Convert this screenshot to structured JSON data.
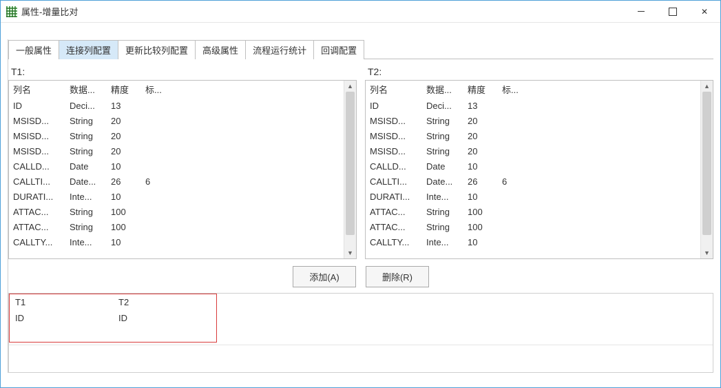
{
  "window": {
    "title": "属性-增量比对"
  },
  "tabs": [
    {
      "label": "一般属性"
    },
    {
      "label": "连接列配置"
    },
    {
      "label": "更新比较列配置"
    },
    {
      "label": "高级属性"
    },
    {
      "label": "流程运行统计"
    },
    {
      "label": "回调配置"
    }
  ],
  "active_tab_index": 1,
  "panes": {
    "left_label": "T1:",
    "right_label": "T2:"
  },
  "grid_headers": {
    "name": "列名",
    "dtype": "数据...",
    "prec": "精度",
    "scale": "标..."
  },
  "t1_rows": [
    {
      "name": "ID",
      "dtype": "Deci...",
      "prec": "13",
      "scale": ""
    },
    {
      "name": "MSISD...",
      "dtype": "String",
      "prec": "20",
      "scale": ""
    },
    {
      "name": "MSISD...",
      "dtype": "String",
      "prec": "20",
      "scale": ""
    },
    {
      "name": "MSISD...",
      "dtype": "String",
      "prec": "20",
      "scale": ""
    },
    {
      "name": "CALLD...",
      "dtype": "Date",
      "prec": "10",
      "scale": ""
    },
    {
      "name": "CALLTI...",
      "dtype": "Date...",
      "prec": "26",
      "scale": "6"
    },
    {
      "name": "DURATI...",
      "dtype": "Inte...",
      "prec": "10",
      "scale": ""
    },
    {
      "name": "ATTAC...",
      "dtype": "String",
      "prec": "100",
      "scale": ""
    },
    {
      "name": "ATTAC...",
      "dtype": "String",
      "prec": "100",
      "scale": ""
    },
    {
      "name": "CALLTY...",
      "dtype": "Inte...",
      "prec": "10",
      "scale": ""
    }
  ],
  "t2_rows": [
    {
      "name": "ID",
      "dtype": "Deci...",
      "prec": "13",
      "scale": ""
    },
    {
      "name": "MSISD...",
      "dtype": "String",
      "prec": "20",
      "scale": ""
    },
    {
      "name": "MSISD...",
      "dtype": "String",
      "prec": "20",
      "scale": ""
    },
    {
      "name": "MSISD...",
      "dtype": "String",
      "prec": "20",
      "scale": ""
    },
    {
      "name": "CALLD...",
      "dtype": "Date",
      "prec": "10",
      "scale": ""
    },
    {
      "name": "CALLTI...",
      "dtype": "Date...",
      "prec": "26",
      "scale": "6"
    },
    {
      "name": "DURATI...",
      "dtype": "Inte...",
      "prec": "10",
      "scale": ""
    },
    {
      "name": "ATTAC...",
      "dtype": "String",
      "prec": "100",
      "scale": ""
    },
    {
      "name": "ATTAC...",
      "dtype": "String",
      "prec": "100",
      "scale": ""
    },
    {
      "name": "CALLTY...",
      "dtype": "Inte...",
      "prec": "10",
      "scale": ""
    }
  ],
  "buttons": {
    "add": "添加(A)",
    "delete": "删除(R)"
  },
  "result": {
    "headers": {
      "c1": "T1",
      "c2": "T2"
    },
    "rows": [
      {
        "c1": "ID",
        "c2": "ID"
      }
    ]
  }
}
